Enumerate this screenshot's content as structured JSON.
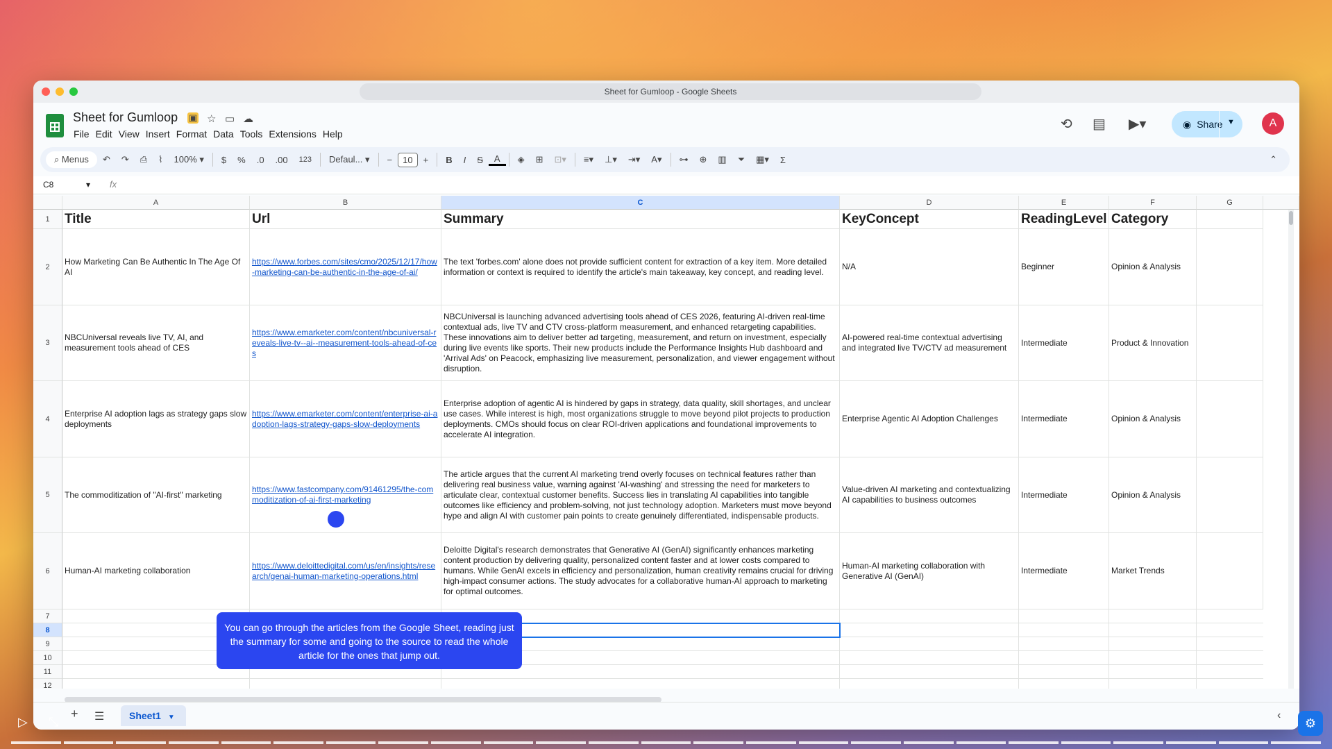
{
  "window": {
    "title": "Sheet for Gumloop - Google Sheets"
  },
  "doc": {
    "title": "Sheet for Gumloop"
  },
  "menu": [
    "File",
    "Edit",
    "View",
    "Insert",
    "Format",
    "Data",
    "Tools",
    "Extensions",
    "Help"
  ],
  "share": {
    "label": "Share"
  },
  "avatar": {
    "initial": "A"
  },
  "toolbar": {
    "search": "Menus",
    "zoom": "100%",
    "currency": "$",
    "percent": "%",
    "dec_less": ".0",
    "dec_more": ".00",
    "number_format": "123",
    "font": "Defaul...",
    "font_size": "10"
  },
  "formula_bar": {
    "cell_ref": "C8",
    "fx": "fx"
  },
  "columns": [
    "A",
    "B",
    "C",
    "D",
    "E",
    "F",
    "G"
  ],
  "rows": [
    "1",
    "2",
    "3",
    "4",
    "5",
    "6",
    "7",
    "8",
    "9",
    "10",
    "11",
    "12"
  ],
  "headers": [
    "Title",
    "Url",
    "Summary",
    "KeyConcept",
    "ReadingLevel",
    "Category"
  ],
  "data": [
    {
      "title": "How Marketing Can Be Authentic In The Age Of AI",
      "url": "https://www.forbes.com/sites/cmo/2025/12/17/how-marketing-can-be-authentic-in-the-age-of-ai/",
      "summary": "The text 'forbes.com' alone does not provide sufficient content for extraction of a key item. More detailed information or context is required to identify the article's main takeaway, key concept, and reading level.",
      "concept": "N/A",
      "level": "Beginner",
      "category": "Opinion & Analysis"
    },
    {
      "title": "NBCUniversal reveals live TV, AI, and measurement tools ahead of CES",
      "url": "https://www.emarketer.com/content/nbcuniversal-reveals-live-tv--ai--measurement-tools-ahead-of-ces",
      "summary": "NBCUniversal is launching advanced advertising tools ahead of CES 2026, featuring AI-driven real-time contextual ads, live TV and CTV cross-platform measurement, and enhanced retargeting capabilities. These innovations aim to deliver better ad targeting, measurement, and return on investment, especially during live events like sports. Their new products include the Performance Insights Hub dashboard and 'Arrival Ads' on Peacock, emphasizing live measurement, personalization, and viewer engagement without disruption.",
      "concept": "AI-powered real-time contextual advertising and integrated live TV/CTV ad measurement",
      "level": "Intermediate",
      "category": "Product & Innovation"
    },
    {
      "title": "Enterprise AI adoption lags as strategy gaps slow deployments",
      "url": "https://www.emarketer.com/content/enterprise-ai-adoption-lags-strategy-gaps-slow-deployments",
      "summary": "Enterprise adoption of agentic AI is hindered by gaps in strategy, data quality, skill shortages, and unclear use cases. While interest is high, most organizations struggle to move beyond pilot projects to production deployments. CMOs should focus on clear ROI-driven applications and foundational improvements to accelerate AI integration.",
      "concept": "Enterprise Agentic AI Adoption Challenges",
      "level": "Intermediate",
      "category": "Opinion & Analysis"
    },
    {
      "title": "The commoditization of \"AI-first\" marketing",
      "url": "https://www.fastcompany.com/91461295/the-commoditization-of-ai-first-marketing",
      "summary": "The article argues that the current AI marketing trend overly focuses on technical features rather than delivering real business value, warning against 'AI-washing' and stressing the need for marketers to articulate clear, contextual customer benefits. Success lies in translating AI capabilities into tangible outcomes like efficiency and problem-solving, not just technology adoption. Marketers must move beyond hype and align AI with customer pain points to create genuinely differentiated, indispensable products.",
      "concept": "Value-driven AI marketing and contextualizing AI capabilities to business outcomes",
      "level": "Intermediate",
      "category": "Opinion & Analysis"
    },
    {
      "title": "Human-AI marketing collaboration",
      "url": "https://www.deloittedigital.com/us/en/insights/research/genai-human-marketing-operations.html",
      "summary": "Deloitte Digital's research demonstrates that Generative AI (GenAI) significantly enhances marketing content production by delivering quality, personalized content faster and at lower costs compared to humans. While GenAI excels in efficiency and personalization, human creativity remains crucial for driving high-impact consumer actions. The study advocates for a collaborative human-AI approach to marketing for optimal outcomes.",
      "concept": "Human-AI marketing collaboration with Generative AI (GenAI)",
      "level": "Intermediate",
      "category": "Market Trends"
    }
  ],
  "tooltip": {
    "text": "You can go through the articles from the Google Sheet, reading just the summary for some and going to the source to read the whole article for the ones that jump out."
  },
  "sheet_tab": {
    "label": "Sheet1"
  }
}
